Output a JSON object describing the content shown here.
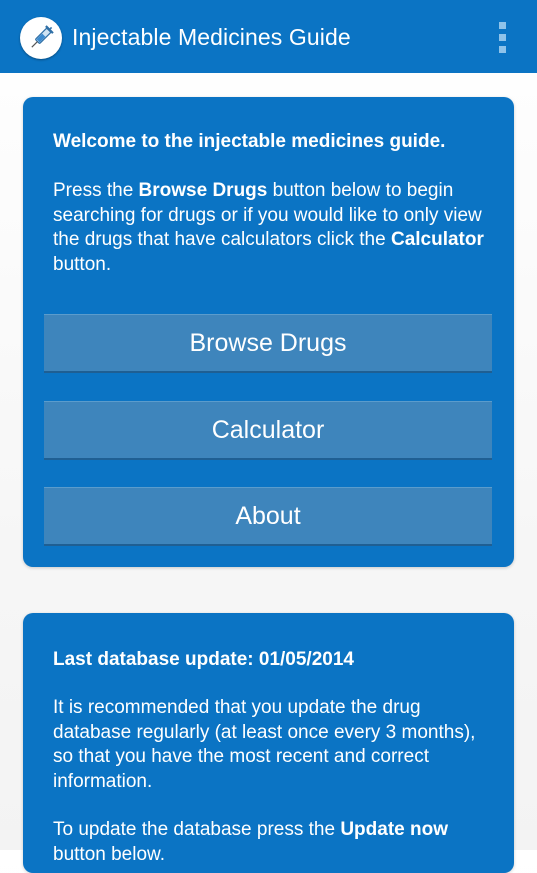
{
  "action_bar": {
    "title": "Injectable Medicines Guide",
    "icon": "syringe-icon",
    "overflow_icon": "overflow-menu-icon"
  },
  "welcome_card": {
    "heading": "Welcome to the injectable medicines guide.",
    "body": {
      "part1": "Press the ",
      "bold1": "Browse Drugs",
      "part2": " button below to begin searching for drugs or if you would like to only view the drugs that have calculators click the ",
      "bold2": "Calculator",
      "part3": " button."
    },
    "buttons": {
      "browse": "Browse Drugs",
      "calculator": "Calculator",
      "about": "About"
    }
  },
  "update_card": {
    "heading": "Last database update: 01/05/2014",
    "paragraph1": "It is recommended that you update the drug database regularly (at least once every 3 months), so that you have the most recent and correct information.",
    "paragraph2": {
      "part1": "To update the database press the ",
      "bold1": "Update now",
      "part2": " button below."
    }
  },
  "colors": {
    "primary": "#0b74c4",
    "button": "#3e85bc",
    "overflow_dots": "#8fc3ea",
    "text": "#ffffff"
  }
}
